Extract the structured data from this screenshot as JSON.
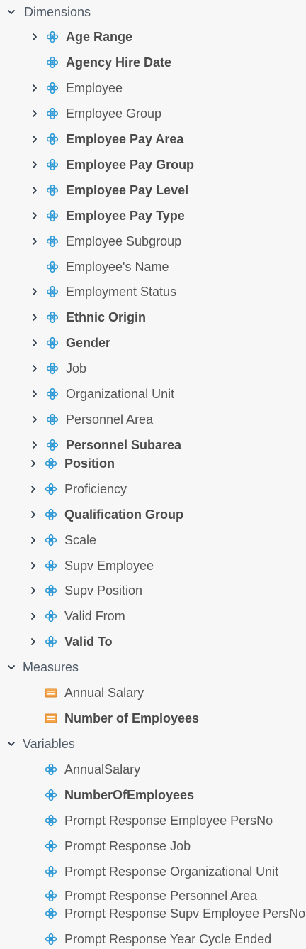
{
  "colors": {
    "accent": "#2b98d6",
    "measure": "#e8943a",
    "text": "#555555",
    "chevron": "#2d3b4a"
  },
  "sections": [
    {
      "id": "dimensions",
      "label": "Dimensions",
      "top": 0,
      "items": [
        {
          "label": "Age Range",
          "bold": true,
          "expandable": true
        },
        {
          "label": "Agency Hire Date",
          "bold": true,
          "expandable": false
        },
        {
          "label": "Employee",
          "bold": false,
          "expandable": true
        },
        {
          "label": "Employee Group",
          "bold": false,
          "expandable": true
        },
        {
          "label": "Employee Pay Area",
          "bold": true,
          "expandable": true
        },
        {
          "label": "Employee Pay Group",
          "bold": true,
          "expandable": true
        },
        {
          "label": "Employee Pay Level",
          "bold": true,
          "expandable": true
        },
        {
          "label": "Employee Pay Type",
          "bold": true,
          "expandable": true
        },
        {
          "label": "Employee Subgroup",
          "bold": false,
          "expandable": true
        },
        {
          "label": "Employee's Name",
          "bold": false,
          "expandable": false
        },
        {
          "label": "Employment Status",
          "bold": false,
          "expandable": true
        },
        {
          "label": "Ethnic Origin",
          "bold": true,
          "expandable": true
        },
        {
          "label": "Gender",
          "bold": true,
          "expandable": true
        },
        {
          "label": "Job",
          "bold": false,
          "expandable": true
        },
        {
          "label": "Organizational Unit",
          "bold": false,
          "expandable": true
        },
        {
          "label": "Personnel Area",
          "bold": false,
          "expandable": true
        },
        {
          "label": "Personnel Subarea",
          "bold": true,
          "expandable": true
        },
        {
          "label": "Position",
          "bold": true,
          "expandable": true
        },
        {
          "label": "Proficiency",
          "bold": false,
          "expandable": true
        },
        {
          "label": "Qualification Group",
          "bold": true,
          "expandable": true
        },
        {
          "label": "Scale",
          "bold": false,
          "expandable": true
        },
        {
          "label": "Supv Employee",
          "bold": false,
          "expandable": true
        },
        {
          "label": "Supv Position",
          "bold": false,
          "expandable": true
        },
        {
          "label": "Valid From",
          "bold": false,
          "expandable": true
        },
        {
          "label": "Valid To",
          "bold": true,
          "expandable": true
        }
      ]
    },
    {
      "id": "measures",
      "label": "Measures",
      "items": [
        {
          "label": "Annual Salary",
          "bold": false,
          "icon": "measure-icon"
        },
        {
          "label": "Number of Employees",
          "bold": true,
          "icon": "measure-icon"
        }
      ]
    },
    {
      "id": "variables",
      "label": "Variables",
      "items": [
        {
          "label": "AnnualSalary",
          "bold": false
        },
        {
          "label": "NumberOfEmployees",
          "bold": true
        },
        {
          "label": "Prompt Response Employee PersNo",
          "bold": false
        },
        {
          "label": "Prompt Response Job",
          "bold": false
        },
        {
          "label": "Prompt Response Organizational Unit",
          "bold": false
        },
        {
          "label": "Prompt Response Personnel Area",
          "bold": false
        },
        {
          "label": "Prompt Response Supv Employee PersNo",
          "bold": false
        },
        {
          "label": "Prompt Response Year Cycle Ended",
          "bold": false
        }
      ]
    }
  ]
}
